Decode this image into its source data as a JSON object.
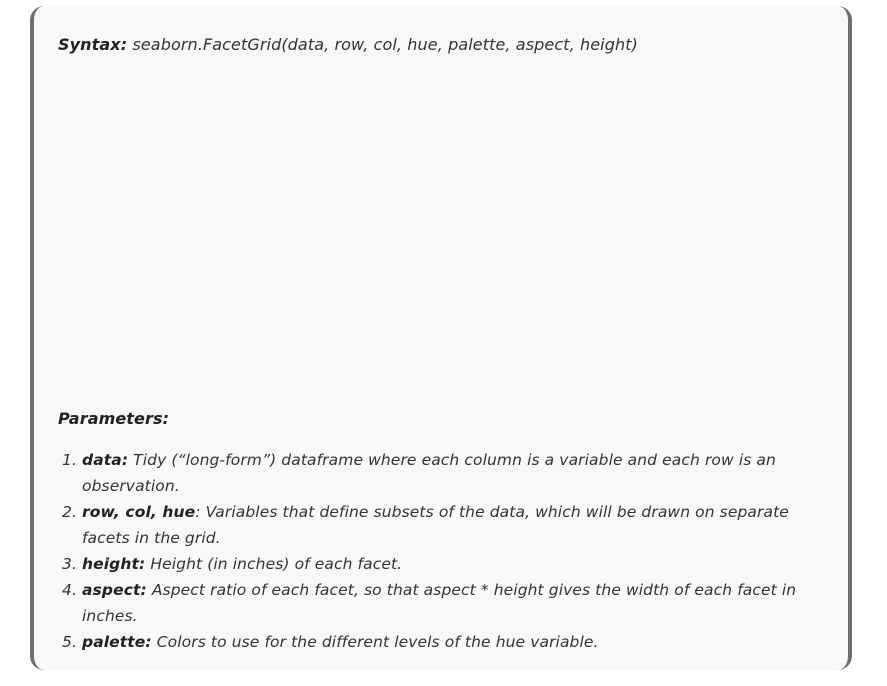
{
  "syntax": {
    "label": "Syntax:",
    "text": " seaborn.FacetGrid(data, row, col, hue, palette, aspect, height)"
  },
  "parameters": {
    "heading": "Parameters:",
    "items": [
      {
        "name": "data:",
        "description": " Tidy (“long-form”) dataframe where each column is a variable and each row is an observation."
      },
      {
        "name": "row, col, hue",
        "description": ": Variables that define subsets of the data, which will be drawn on separate facets in the grid."
      },
      {
        "name": "height:",
        "description": " Height (in inches) of each facet."
      },
      {
        "name": "aspect:",
        "description": " Aspect ratio of each facet, so that aspect * height gives the width of each facet in inches."
      },
      {
        "name": "palette:",
        "description": " Colors to use for the different levels of the hue variable."
      }
    ]
  }
}
